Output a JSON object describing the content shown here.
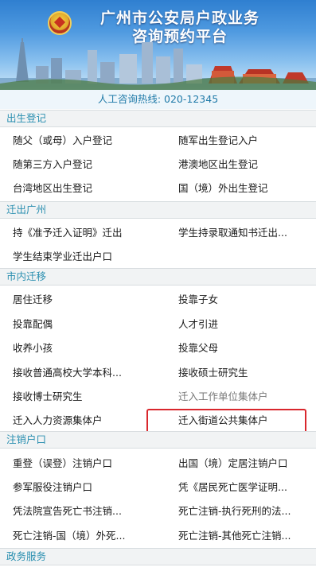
{
  "header": {
    "title_line1": "广州市公安局户政业务",
    "title_line2": "咨询预约平台"
  },
  "hotline": "人工咨询热线: 020-12345",
  "sections": [
    {
      "title": "出生登记",
      "items": [
        "随父（或母）入户登记",
        "随军出生登记入户",
        "随第三方入户登记",
        "港澳地区出生登记",
        "台湾地区出生登记",
        "国（境）外出生登记"
      ]
    },
    {
      "title": "迁出广州",
      "items": [
        "持《准予迁入证明》迁出",
        "学生持录取通知书迁出...",
        "学生结束学业迁出户口"
      ]
    },
    {
      "title": "市内迁移",
      "items": [
        "居住迁移",
        "投靠子女",
        "投靠配偶",
        "人才引进",
        "收养小孩",
        "投靠父母",
        "接收普通高校大学本科...",
        "接收硕士研究生",
        "接收博士研究生",
        "迁入工作单位集体户",
        "迁入人力资源集体户",
        "迁入街道公共集体户"
      ]
    },
    {
      "title": "注销户口",
      "items": [
        "重登（误登）注销户口",
        "出国（境）定居注销户口",
        "参军服役注销户口",
        "凭《居民死亡医学证明...",
        "凭法院宣告死亡书注销...",
        "死亡注销-执行死刑的法...",
        "死亡注销-国（境）外死...",
        "死亡注销-其他死亡注销..."
      ]
    },
    {
      "title": "政务服务",
      "items": []
    }
  ],
  "highlighted_item": "迁入街道公共集体户",
  "colors": {
    "section_title": "#2a8fb0",
    "highlight": "#d9272d",
    "hotline": "#1f7aa8"
  }
}
